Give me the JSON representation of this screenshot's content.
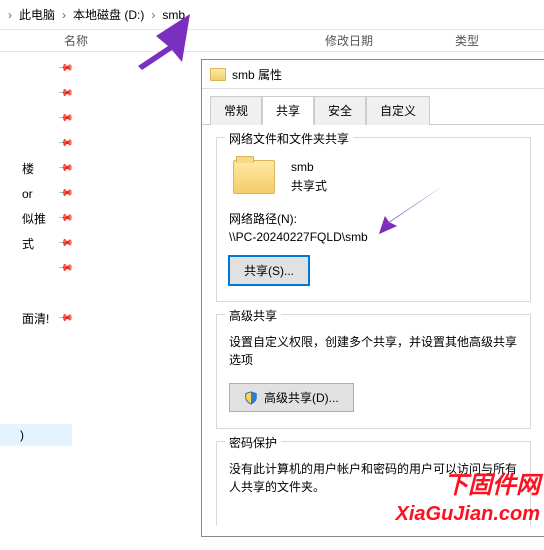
{
  "breadcrumb": {
    "seg1": "此电脑",
    "seg2": "本地磁盘 (D:)",
    "seg3": "smb"
  },
  "columns": {
    "name": "名称",
    "date": "修改日期",
    "type": "类型"
  },
  "tree": {
    "items": [
      "",
      "",
      "",
      "",
      "楼",
      "or",
      "似推",
      "式",
      "",
      "面清!",
      ""
    ],
    "sel": ")"
  },
  "dlg": {
    "title": "smb 属性",
    "tabs": {
      "t1": "常规",
      "t2": "共享",
      "t3": "安全",
      "t4": "自定义"
    },
    "group1": {
      "legend": "网络文件和文件夹共享",
      "name": "smb",
      "status": "共享式",
      "netLabel": "网络路径(N):",
      "netPath": "\\\\PC-20240227FQLD\\smb",
      "shareBtn": "共享(S)..."
    },
    "group2": {
      "legend": "高级共享",
      "text": "设置自定义权限，创建多个共享，并设置其他高级共享选项",
      "btn": "高级共享(D)..."
    },
    "group3": {
      "legend": "密码保护",
      "text": "没有此计算机的用户帐户和密码的用户可以访问与所有人共享的文件夹。"
    }
  },
  "watermark": {
    "line1": "下固件网",
    "line2": "XiaGuJian.com"
  }
}
